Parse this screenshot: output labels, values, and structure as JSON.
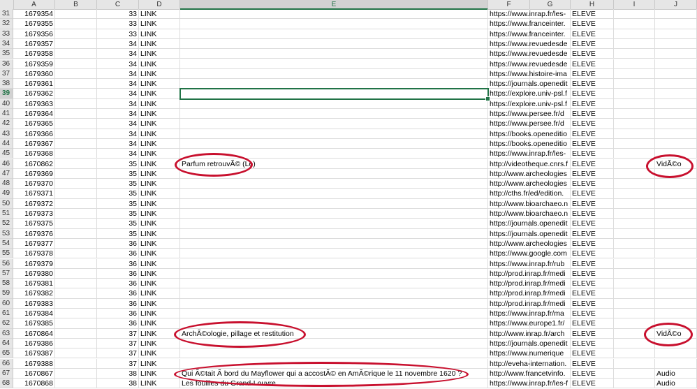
{
  "columns": [
    "A",
    "B",
    "C",
    "D",
    "E",
    "F",
    "G",
    "H",
    "I",
    "J"
  ],
  "active_column": "E",
  "active_row": 39,
  "rows": [
    {
      "n": 31,
      "a": "1679354",
      "c": "33",
      "d": "LINK",
      "e": "",
      "f": "https://www.inrap.fr/les-",
      "h": "ELEVE",
      "j": ""
    },
    {
      "n": 32,
      "a": "1679355",
      "c": "33",
      "d": "LINK",
      "e": "",
      "f": "https://www.franceinter.",
      "h": "ELEVE",
      "j": ""
    },
    {
      "n": 33,
      "a": "1679356",
      "c": "33",
      "d": "LINK",
      "e": "",
      "f": "https://www.franceinter.",
      "h": "ELEVE",
      "j": ""
    },
    {
      "n": 34,
      "a": "1679357",
      "c": "34",
      "d": "LINK",
      "e": "",
      "f": "https://www.revuedesde",
      "h": "ELEVE",
      "j": ""
    },
    {
      "n": 35,
      "a": "1679358",
      "c": "34",
      "d": "LINK",
      "e": "",
      "f": "https://www.revuedesde",
      "h": "ELEVE",
      "j": ""
    },
    {
      "n": 36,
      "a": "1679359",
      "c": "34",
      "d": "LINK",
      "e": "",
      "f": "https://www.revuedesde",
      "h": "ELEVE",
      "j": ""
    },
    {
      "n": 37,
      "a": "1679360",
      "c": "34",
      "d": "LINK",
      "e": "",
      "f": "https://www.histoire-ima",
      "h": "ELEVE",
      "j": ""
    },
    {
      "n": 38,
      "a": "1679361",
      "c": "34",
      "d": "LINK",
      "e": "",
      "f": "https://journals.openedit",
      "h": "ELEVE",
      "j": ""
    },
    {
      "n": 39,
      "a": "1679362",
      "c": "34",
      "d": "LINK",
      "e": "",
      "f": "https://explore.univ-psl.f",
      "h": "ELEVE",
      "j": ""
    },
    {
      "n": 40,
      "a": "1679363",
      "c": "34",
      "d": "LINK",
      "e": "",
      "f": "https://explore.univ-psl.f",
      "h": "ELEVE",
      "j": ""
    },
    {
      "n": 41,
      "a": "1679364",
      "c": "34",
      "d": "LINK",
      "e": "",
      "f": "https://www.persee.fr/d",
      "h": "ELEVE",
      "j": ""
    },
    {
      "n": 42,
      "a": "1679365",
      "c": "34",
      "d": "LINK",
      "e": "",
      "f": "https://www.persee.fr/d",
      "h": "ELEVE",
      "j": ""
    },
    {
      "n": 43,
      "a": "1679366",
      "c": "34",
      "d": "LINK",
      "e": "",
      "f": "https://books.openeditio",
      "h": "ELEVE",
      "j": ""
    },
    {
      "n": 44,
      "a": "1679367",
      "c": "34",
      "d": "LINK",
      "e": "",
      "f": "https://books.openeditio",
      "h": "ELEVE",
      "j": ""
    },
    {
      "n": 45,
      "a": "1679368",
      "c": "34",
      "d": "LINK",
      "e": "",
      "f": "https://www.inrap.fr/les-",
      "h": "ELEVE",
      "j": ""
    },
    {
      "n": 46,
      "a": "1670862",
      "c": "35",
      "d": "LINK",
      "e": "Parfum retrouvÃ© (Le)",
      "f": "http://videotheque.cnrs.f",
      "h": "ELEVE",
      "j": "VidÃ©o"
    },
    {
      "n": 47,
      "a": "1679369",
      "c": "35",
      "d": "LINK",
      "e": "",
      "f": "http://www.archeologies",
      "h": "ELEVE",
      "j": ""
    },
    {
      "n": 48,
      "a": "1679370",
      "c": "35",
      "d": "LINK",
      "e": "",
      "f": "http://www.archeologies",
      "h": "ELEVE",
      "j": ""
    },
    {
      "n": 49,
      "a": "1679371",
      "c": "35",
      "d": "LINK",
      "e": "",
      "f": "http://cths.fr/ed/edition.",
      "h": "ELEVE",
      "j": ""
    },
    {
      "n": 50,
      "a": "1679372",
      "c": "35",
      "d": "LINK",
      "e": "",
      "f": "http://www.bioarchaeo.n",
      "h": "ELEVE",
      "j": ""
    },
    {
      "n": 51,
      "a": "1679373",
      "c": "35",
      "d": "LINK",
      "e": "",
      "f": "http://www.bioarchaeo.n",
      "h": "ELEVE",
      "j": ""
    },
    {
      "n": 52,
      "a": "1679375",
      "c": "35",
      "d": "LINK",
      "e": "",
      "f": "https://journals.openedit",
      "h": "ELEVE",
      "j": ""
    },
    {
      "n": 53,
      "a": "1679376",
      "c": "35",
      "d": "LINK",
      "e": "",
      "f": "https://journals.openedit",
      "h": "ELEVE",
      "j": ""
    },
    {
      "n": 54,
      "a": "1679377",
      "c": "36",
      "d": "LINK",
      "e": "",
      "f": "http://www.archeologies",
      "h": "ELEVE",
      "j": ""
    },
    {
      "n": 55,
      "a": "1679378",
      "c": "36",
      "d": "LINK",
      "e": "",
      "f": "https://www.google.com",
      "h": "ELEVE",
      "j": ""
    },
    {
      "n": 56,
      "a": "1679379",
      "c": "36",
      "d": "LINK",
      "e": "",
      "f": "https://www.inrap.fr/rub",
      "h": "ELEVE",
      "j": ""
    },
    {
      "n": 57,
      "a": "1679380",
      "c": "36",
      "d": "LINK",
      "e": "",
      "f": "http://prod.inrap.fr/medi",
      "h": "ELEVE",
      "j": ""
    },
    {
      "n": 58,
      "a": "1679381",
      "c": "36",
      "d": "LINK",
      "e": "",
      "f": "http://prod.inrap.fr/medi",
      "h": "ELEVE",
      "j": ""
    },
    {
      "n": 59,
      "a": "1679382",
      "c": "36",
      "d": "LINK",
      "e": "",
      "f": "http://prod.inrap.fr/medi",
      "h": "ELEVE",
      "j": ""
    },
    {
      "n": 60,
      "a": "1679383",
      "c": "36",
      "d": "LINK",
      "e": "",
      "f": "http://prod.inrap.fr/medi",
      "h": "ELEVE",
      "j": ""
    },
    {
      "n": 61,
      "a": "1679384",
      "c": "36",
      "d": "LINK",
      "e": "",
      "f": "https://www.inrap.fr/ma",
      "h": "ELEVE",
      "j": ""
    },
    {
      "n": 62,
      "a": "1679385",
      "c": "36",
      "d": "LINK",
      "e": "",
      "f": "https://www.europe1.fr/",
      "h": "ELEVE",
      "j": ""
    },
    {
      "n": 63,
      "a": "1670864",
      "c": "37",
      "d": "LINK",
      "e": "ArchÃ©ologie, pillage et restitution",
      "f": "http://www.inrap.fr/arch",
      "h": "ELEVE",
      "j": "VidÃ©o"
    },
    {
      "n": 64,
      "a": "1679386",
      "c": "37",
      "d": "LINK",
      "e": "",
      "f": "https://journals.openedit",
      "h": "ELEVE",
      "j": ""
    },
    {
      "n": 65,
      "a": "1679387",
      "c": "37",
      "d": "LINK",
      "e": "",
      "f": "https://www.numerique",
      "h": "ELEVE",
      "j": ""
    },
    {
      "n": 66,
      "a": "1679388",
      "c": "37",
      "d": "LINK",
      "e": "",
      "f": "http://eveha-internation.",
      "h": "ELEVE",
      "j": ""
    },
    {
      "n": 67,
      "a": "1670867",
      "c": "38",
      "d": "LINK",
      "e": "Qui Ã©tait Ã  bord du Mayflower qui a accostÃ© en AmÃ©rique le 11 novembre 1620 ?",
      "f": "http://www.francetvinfo.",
      "h": "ELEVE",
      "j": "Audio"
    },
    {
      "n": 68,
      "a": "1670868",
      "c": "38",
      "d": "LINK",
      "e": "Les fouilles du Grand-Louvre",
      "f": "https://www.inrap.fr/les-f",
      "h": "ELEVE",
      "j": "Audio"
    }
  ]
}
